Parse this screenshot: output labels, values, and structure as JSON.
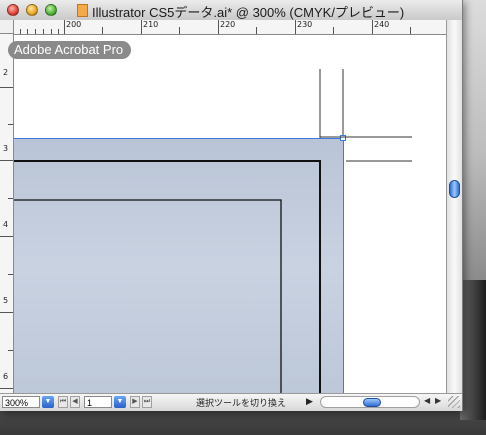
{
  "window": {
    "title": "Illustrator CS5データ.ai* @ 300% (CMYK/プレビュー)"
  },
  "ruler_top": {
    "labels": [
      "200",
      "210",
      "220",
      "230",
      "240"
    ]
  },
  "ruler_left": {
    "labels": [
      "2",
      "3",
      "4",
      "5",
      "6"
    ]
  },
  "overlay": {
    "acrobat_badge": "Adobe Acrobat Pro"
  },
  "status_bar": {
    "zoom": "300%",
    "page": "1",
    "tool_status": "選択ツールを切り換え"
  },
  "icons": {
    "close": "close-icon",
    "minimize": "minimize-icon",
    "zoom": "zoom-icon",
    "document": "document-icon",
    "first_page": "first-page-icon",
    "prev_page": "prev-page-icon",
    "next_page": "next-page-icon",
    "last_page": "last-page-icon",
    "dropdown": "chevron-down-icon"
  },
  "colors": {
    "artboard_fill": "#c3cddd",
    "selection_blue": "#3b7be0",
    "scroll_thumb": "#2f6fd0"
  }
}
